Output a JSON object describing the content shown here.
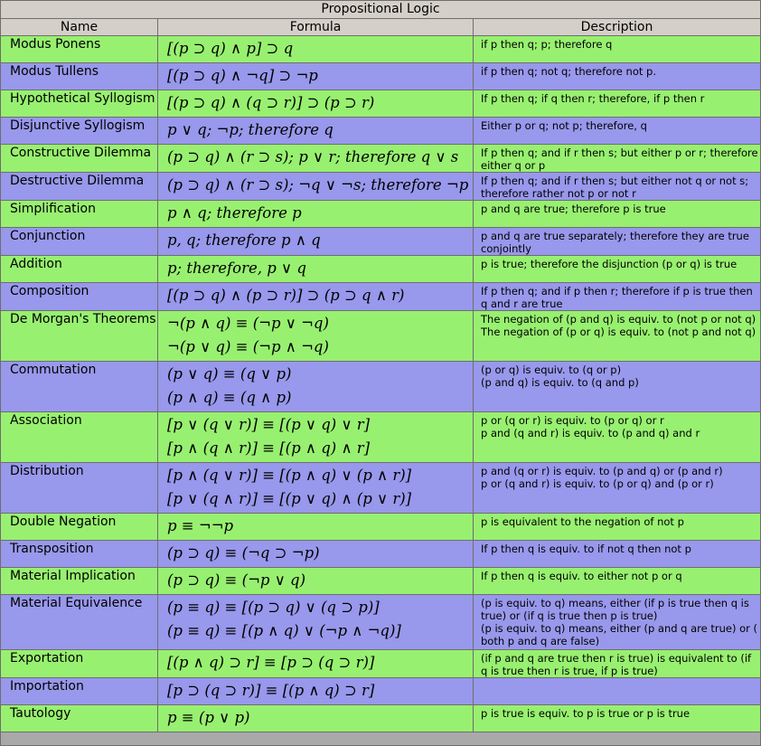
{
  "table": {
    "title": "Propositional Logic",
    "headers": {
      "name": "Name",
      "formula": "Formula",
      "description": "Description"
    },
    "rows": [
      {
        "name": "Modus Ponens",
        "color": "green",
        "h": 24,
        "formulas": [
          "[(p ⊃ q) ∧ p] ⊃ q"
        ],
        "description": [
          "if p then q; p; therefore q"
        ]
      },
      {
        "name": "Modus Tullens",
        "color": "blue",
        "h": 25,
        "formulas": [
          "[(p ⊃ q) ∧ ¬q] ⊃ ¬p"
        ],
        "description": [
          "if p then q; not q; therefore not p."
        ]
      },
      {
        "name": "Hypothetical Syllogism",
        "color": "green",
        "h": 25,
        "formulas": [
          "[(p ⊃ q) ∧ (q ⊃ r)] ⊃ (p ⊃ r)"
        ],
        "description": [
          "If p then q; if q then r; therefore, if p then r"
        ]
      },
      {
        "name": "Disjunctive Syllogism",
        "color": "blue",
        "h": 25,
        "formulas": [
          "p ∨ q; ¬p; therefore q"
        ],
        "description": [
          "Either p or q; not p; therefore, q"
        ]
      },
      {
        "name": "Constructive Dilemma",
        "color": "green",
        "h": 31,
        "formulas": [
          "(p ⊃ q) ∧ (r ⊃ s); p ∨ r; therefore q ∨ s"
        ],
        "description": [
          "If p then q; and if r then s; but either p or r; therefore either q or p"
        ]
      },
      {
        "name": "Destructive Dilemma",
        "color": "blue",
        "h": 31,
        "formulas": [
          "(p ⊃ q) ∧ (r ⊃ s); ¬q ∨ ¬s; therefore ¬p ∨ ¬r"
        ],
        "description": [
          "If p then q; and if r then s; but either not q or not s; therefore rather not p or not r"
        ]
      },
      {
        "name": "Simplification",
        "color": "green",
        "h": 25,
        "formulas": [
          "p ∧ q; therefore p"
        ],
        "description": [
          "p and q are true; therefore p is true"
        ]
      },
      {
        "name": "Conjunction",
        "color": "blue",
        "h": 31,
        "formulas": [
          "p, q; therefore p ∧ q"
        ],
        "description": [
          "p and q are true separately; therefore they are true conjointly"
        ]
      },
      {
        "name": "Addition",
        "color": "green",
        "h": 25,
        "formulas": [
          "p; therefore, p ∨ q"
        ],
        "description": [
          "p is true; therefore the disjunction (p or q) is true"
        ]
      },
      {
        "name": "Composition",
        "color": "blue",
        "h": 31,
        "formulas": [
          "[(p ⊃ q) ∧ (p ⊃ r)] ⊃ (p ⊃ q ∧ r)"
        ],
        "description": [
          "If p then q; and if p then r; therefore if p is true then q and r are true"
        ]
      },
      {
        "name": "De Morgan's Theorems",
        "color": "green",
        "h": 51,
        "formulas": [
          "¬(p ∧ q) ≡ (¬p ∨ ¬q)",
          "¬(p ∨ q) ≡ (¬p ∧ ¬q)"
        ],
        "description": [
          "The negation of (p and q) is equiv. to (not p or not q)",
          "The negation of (p or q) is equiv. to (not p and not q)"
        ]
      },
      {
        "name": "Commutation",
        "color": "blue",
        "h": 51,
        "formulas": [
          "(p ∨ q) ≡ (q ∨ p)",
          "(p ∧ q) ≡ (q ∧ p)"
        ],
        "description": [
          "(p or q) is equiv. to (q or p)",
          "(p and q) is equiv. to (q and p)"
        ]
      },
      {
        "name": "Association",
        "color": "green",
        "h": 51,
        "formulas": [
          "[p ∨ (q ∨ r)] ≡ [(p ∨ q) ∨ r]",
          "[p ∧ (q ∧ r)] ≡ [(p ∧ q) ∧ r]"
        ],
        "description": [
          "p or (q or r) is equiv. to (p or q) or r",
          "p and (q and r) is equiv. to (p and q) and r"
        ]
      },
      {
        "name": "Distribution",
        "color": "blue",
        "h": 51,
        "formulas": [
          "[p ∧ (q ∨ r)] ≡ [(p ∧ q) ∨ (p ∧ r)]",
          "[p ∨ (q ∧ r)] ≡ [(p ∨ q) ∧ (p ∨ r)]"
        ],
        "description": [
          "p and (q or r) is equiv. to (p and q) or (p and r)",
          "p or (q and r) is equiv. to (p or q) and (p or r)"
        ]
      },
      {
        "name": "Double Negation",
        "color": "green",
        "h": 19,
        "formulas": [
          "p ≡ ¬¬p"
        ],
        "description": [
          "p is equivalent to the negation of not p"
        ]
      },
      {
        "name": "Transposition",
        "color": "blue",
        "h": 25,
        "formulas": [
          "(p ⊃ q) ≡ (¬q ⊃ ¬p)"
        ],
        "description": [
          "If p then q is equiv. to if not q then not p"
        ]
      },
      {
        "name": "Material Implication",
        "color": "green",
        "h": 25,
        "formulas": [
          "(p ⊃ q) ≡ (¬p ∨ q)"
        ],
        "description": [
          "If p then q is equiv. to either not p or q"
        ]
      },
      {
        "name": "Material Equivalence",
        "color": "blue",
        "h": 61,
        "formulas": [
          "(p ≡ q) ≡ [(p ⊃ q) ∨ (q ⊃ p)]",
          "(p ≡ q) ≡ [(p ∧ q) ∨ (¬p ∧ ¬q)]"
        ],
        "description": [
          "(p is equiv. to q) means, either (if p is true then q is true) or (if q is true then p is true)",
          "(p is equiv. to q) means, either (p and q are true) or ( both p and q are false)"
        ]
      },
      {
        "name": "Exportation",
        "color": "green",
        "h": 31,
        "formulas": [
          "[(p ∧ q) ⊃ r] ≡ [p ⊃ (q ⊃ r)]"
        ],
        "description": [
          "(if p and q are true then r is true) is equivalent to (if q is true then r is true, if p is true)"
        ]
      },
      {
        "name": "Importation",
        "color": "blue",
        "h": 25,
        "formulas": [
          "[p ⊃ (q ⊃ r)] ≡ [(p ∧ q) ⊃ r]"
        ],
        "description": []
      },
      {
        "name": "Tautology",
        "color": "green",
        "h": 25,
        "formulas": [
          "p ≡ (p ∨ p)"
        ],
        "description": [
          "p is true is equiv. to p is true or p is true"
        ]
      }
    ]
  }
}
